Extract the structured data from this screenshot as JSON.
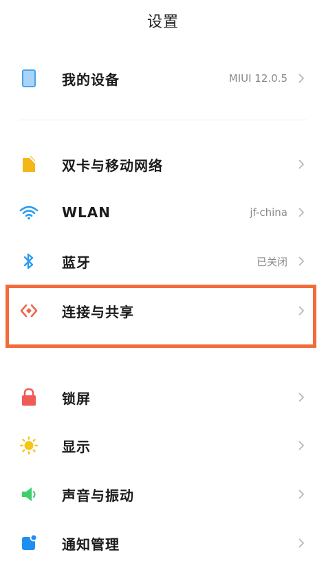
{
  "header": {
    "title": "设置"
  },
  "rows": [
    {
      "label": "我的设备",
      "value": "MIUI 12.0.5",
      "icon": "device-icon"
    },
    {
      "label": "双卡与移动网络",
      "value": "",
      "icon": "sim-card-icon"
    },
    {
      "label": "WLAN",
      "value": "jf-china",
      "icon": "wifi-icon"
    },
    {
      "label": "蓝牙",
      "value": "已关闭",
      "icon": "bluetooth-icon"
    },
    {
      "label": "连接与共享",
      "value": "",
      "icon": "connection-sharing-icon"
    },
    {
      "label": "锁屏",
      "value": "",
      "icon": "lock-icon"
    },
    {
      "label": "显示",
      "value": "",
      "icon": "sun-icon"
    },
    {
      "label": "声音与振动",
      "value": "",
      "icon": "speaker-icon"
    },
    {
      "label": "通知管理",
      "value": "",
      "icon": "notification-icon"
    }
  ],
  "colors": {
    "highlight": "#f26b3a",
    "device": "#4aa3ea",
    "sim": "#f5b617",
    "wifi": "#2b9cf0",
    "bluetooth": "#2b9cf0",
    "connection": "#f0644a",
    "lock": "#f05b57",
    "sun": "#f5c518",
    "speaker": "#3ecf6c",
    "notification": "#1e8ff0"
  }
}
